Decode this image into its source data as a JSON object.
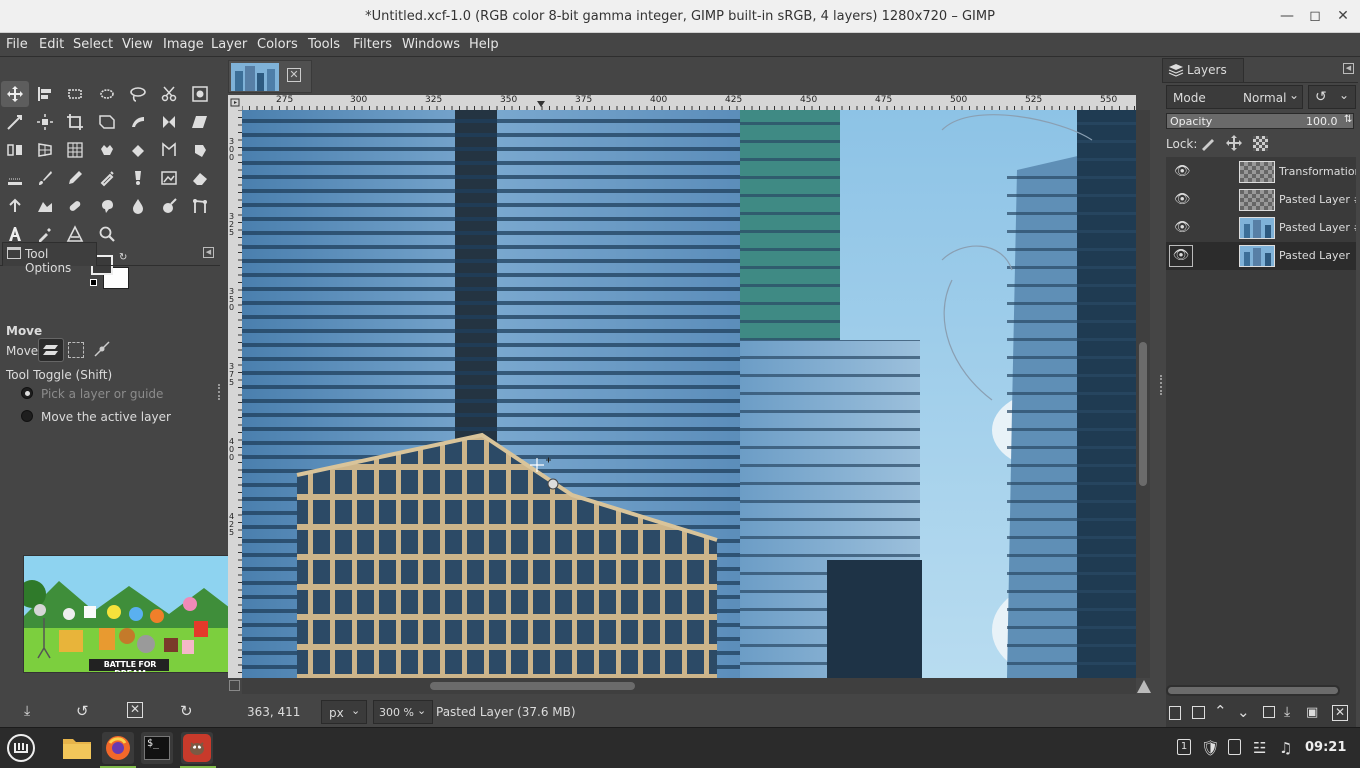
{
  "window": {
    "title": "*Untitled.xcf-1.0 (RGB color 8-bit gamma integer, GIMP built-in sRGB, 4 layers) 1280x720 – GIMP"
  },
  "menu": [
    "File",
    "Edit",
    "Select",
    "View",
    "Image",
    "Layer",
    "Colors",
    "Tools",
    "Filters",
    "Windows",
    "Help"
  ],
  "tool_options": {
    "tab_label": "Tool Options",
    "tool_name": "Move",
    "move_label": "Move:",
    "toggle_label": "Tool Toggle  (Shift)",
    "option_pick": "Pick a layer or guide",
    "option_move": "Move the active layer",
    "thumb_title": "BATTLE FOR DREAM"
  },
  "ruler_top_labels": [
    "275",
    "300",
    "325",
    "350",
    "375",
    "400",
    "425",
    "450",
    "475",
    "500",
    "525",
    "550"
  ],
  "ruler_left_labels": [
    "3\n0\n0",
    "3\n2\n5",
    "3\n5\n0",
    "3\n7\n5",
    "4\n0\n0",
    "4\n2\n5"
  ],
  "status": {
    "coords": "363, 411",
    "unit": "px",
    "zoom": "300 %",
    "message": "Pasted Layer (37.6 MB)"
  },
  "layers_panel": {
    "tab_label": "Layers",
    "mode_label": "Mode",
    "mode_value": "Normal",
    "opacity_label": "Opacity",
    "opacity_value": "100.0",
    "opacity_fraction": 1.0,
    "lock_label": "Lock:",
    "layers": [
      {
        "name": "Transformation",
        "thumb": "transparent",
        "selected": false
      },
      {
        "name": "Pasted Layer #",
        "thumb": "transparent",
        "selected": false
      },
      {
        "name": "Pasted Layer #",
        "thumb": "photo",
        "selected": false
      },
      {
        "name": "Pasted Layer",
        "thumb": "photo",
        "selected": true
      }
    ]
  },
  "taskbar": {
    "clock": "09:21",
    "apps": [
      "mint-menu-icon",
      "files-icon",
      "firefox-icon",
      "terminal-icon",
      "gimp-icon"
    ]
  },
  "colors": {
    "accent": "#c83a2b",
    "panel": "#454545",
    "selected_row": "#2c2c2c"
  }
}
